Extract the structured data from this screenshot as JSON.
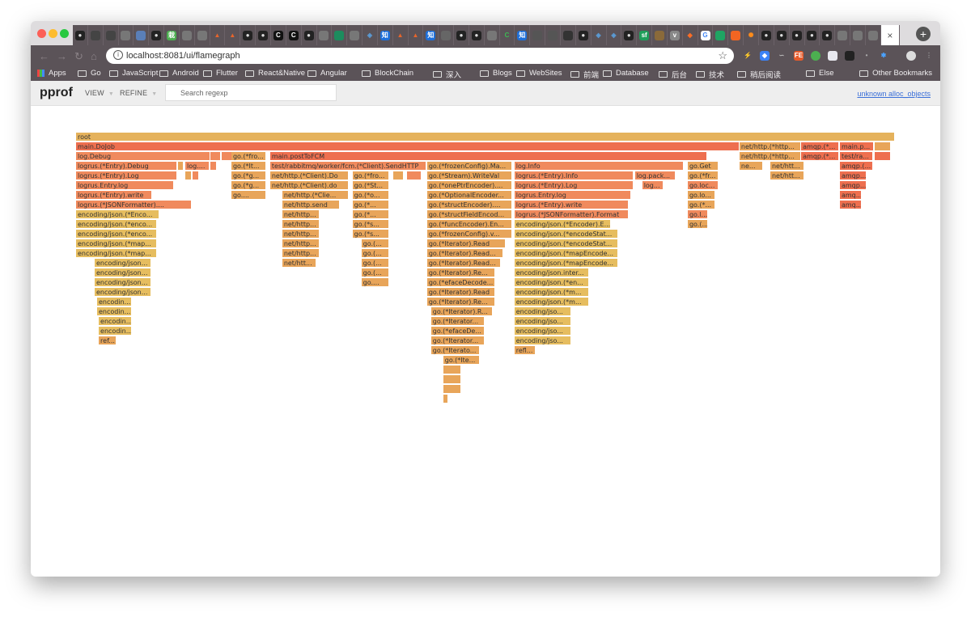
{
  "browser": {
    "tab_icons": [
      "github",
      "cat",
      "cat",
      "gray",
      "avatar",
      "github",
      "kanji-green",
      "gray",
      "gray",
      "triangle-orange",
      "triangle-orange",
      "github",
      "github",
      "c-circle",
      "c-circle",
      "github",
      "gray",
      "green-shield",
      "gray",
      "stack-blue",
      "zhi-blue",
      "triangle-orange",
      "triangle-orange",
      "zhi-blue",
      "book",
      "github",
      "github",
      "gray",
      "c-green",
      "zhi-blue",
      "cat-photo",
      "cat-photo",
      "dark-photo",
      "github",
      "stack-blue",
      "stack-blue",
      "github",
      "sf-green",
      "photo",
      "v-gray",
      "gitlab",
      "google",
      "green-tag",
      "orange-box",
      "gear-orange",
      "github",
      "github",
      "github",
      "github",
      "github",
      "gray",
      "gray",
      "gray"
    ],
    "tab_close": "×",
    "new_tab": "+",
    "address_url": "localhost:8081/ui/flamegraph",
    "bookmarks": [
      {
        "label": "Apps",
        "type": "apps"
      },
      {
        "label": "Go",
        "type": "folder"
      },
      {
        "label": "JavaScript",
        "type": "folder"
      },
      {
        "label": "Android",
        "type": "folder"
      },
      {
        "label": "Flutter",
        "type": "folder"
      },
      {
        "label": "React&Native",
        "type": "folder"
      },
      {
        "label": "Angular",
        "type": "folder"
      },
      {
        "label": "BlockChain",
        "type": "folder"
      },
      {
        "label": "深入",
        "type": "folder"
      },
      {
        "label": "Blogs",
        "type": "folder"
      },
      {
        "label": "WebSites",
        "type": "folder"
      },
      {
        "label": "前端",
        "type": "folder"
      },
      {
        "label": "Database",
        "type": "folder"
      },
      {
        "label": "后台",
        "type": "folder"
      },
      {
        "label": "技术",
        "type": "folder"
      },
      {
        "label": "稍后阅读",
        "type": "folder"
      },
      {
        "label": "Else",
        "type": "folder"
      }
    ],
    "other_bookmarks": "Other Bookmarks"
  },
  "app": {
    "title": "pprof",
    "menu": [
      {
        "label": "VIEW"
      },
      {
        "label": "REFINE"
      }
    ],
    "search_placeholder": "Search regexp",
    "sample_type": "unknown alloc_objects"
  },
  "colors": {
    "warm": "#f08a5d",
    "hot": "#ee6f4f",
    "mid": "#e8a55a",
    "cool": "#e6bd5f",
    "root": "#e5b25c"
  },
  "flamegraph": {
    "frames": [
      {
        "n": "root",
        "d": 0,
        "s": 0,
        "w": 1,
        "c": "root"
      },
      {
        "n": "main.DoJob",
        "d": 1,
        "s": 0,
        "w": 0.8102,
        "c": "hot"
      },
      {
        "n": "net/http.(*http...",
        "d": 1,
        "s": 0.8102,
        "w": 0.0753,
        "c": "mid"
      },
      {
        "n": "amqp.(*...",
        "d": 1,
        "s": 0.8855,
        "w": 0.0464,
        "c": "hot"
      },
      {
        "n": "main.p...",
        "d": 1,
        "s": 0.9328,
        "w": 0.0416,
        "c": "hot"
      },
      {
        "n": "",
        "d": 1,
        "s": 0.9753,
        "w": 0.0198,
        "c": "mid"
      },
      {
        "n": "log.Debug",
        "d": 2,
        "s": 0,
        "w": 0.164,
        "c": "warm"
      },
      {
        "n": "",
        "d": 2,
        "s": 0.164,
        "w": 0.0128,
        "c": "warm"
      },
      {
        "n": "",
        "d": 2,
        "s": 0.1779,
        "w": 0.0128,
        "c": "warm"
      },
      {
        "n": "go.(*fro...",
        "d": 2,
        "s": 0.1897,
        "w": 0.0425,
        "c": "mid"
      },
      {
        "n": "main.postToFCM",
        "d": 2,
        "s": 0.237,
        "w": 0.5336,
        "c": "hot"
      },
      {
        "n": "net/http.(*http...",
        "d": 2,
        "s": 0.8102,
        "w": 0.0753,
        "c": "mid"
      },
      {
        "n": "amqp.(*...",
        "d": 2,
        "s": 0.8855,
        "w": 0.0464,
        "c": "hot"
      },
      {
        "n": "test/ra...",
        "d": 2,
        "s": 0.9328,
        "w": 0.0407,
        "c": "hot"
      },
      {
        "n": "",
        "d": 2,
        "s": 0.9753,
        "w": 0.0198,
        "c": "hot"
      },
      {
        "n": "logrus.(*Entry).Debug",
        "d": 3,
        "s": 0,
        "w": 0.1235,
        "c": "warm"
      },
      {
        "n": "",
        "d": 3,
        "s": 0.1245,
        "w": 0.007,
        "c": "mid"
      },
      {
        "n": "log....",
        "d": 3,
        "s": 0.1334,
        "w": 0.0297,
        "c": "warm"
      },
      {
        "n": "",
        "d": 3,
        "s": 0.164,
        "w": 0.0079,
        "c": "warm"
      },
      {
        "n": "go.(*It...",
        "d": 3,
        "s": 0.1897,
        "w": 0.0425,
        "c": "mid"
      },
      {
        "n": "test/rabbitmq/worker/fcm.(*Client).SendHTTP",
        "d": 3,
        "s": 0.237,
        "w": 0.1907,
        "c": "warm"
      },
      {
        "n": "go.(*frozenConfig).Ma...",
        "d": 3,
        "s": 0.4287,
        "w": 0.1037,
        "c": "mid"
      },
      {
        "n": "log.Info",
        "d": 3,
        "s": 0.5353,
        "w": 0.2065,
        "c": "warm"
      },
      {
        "n": "go.Get",
        "d": 3,
        "s": 0.747,
        "w": 0.0375,
        "c": "mid"
      },
      {
        "n": "ne...",
        "d": 3,
        "s": 0.8102,
        "w": 0.0287,
        "c": "mid"
      },
      {
        "n": "net/htt...",
        "d": 3,
        "s": 0.8478,
        "w": 0.0416,
        "c": "mid"
      },
      {
        "n": "amqp.(...",
        "d": 3,
        "s": 0.9328,
        "w": 0.0407,
        "c": "hot"
      },
      {
        "n": "logrus.(*Entry).Log",
        "d": 4,
        "s": 0,
        "w": 0.1235,
        "c": "warm"
      },
      {
        "n": "",
        "d": 4,
        "s": 0.1334,
        "w": 0.0079,
        "c": "mid"
      },
      {
        "n": "",
        "d": 4,
        "s": 0.1423,
        "w": 0.0079,
        "c": "warm"
      },
      {
        "n": "go.(*g...",
        "d": 4,
        "s": 0.1897,
        "w": 0.0425,
        "c": "mid"
      },
      {
        "n": "net/http.(*Client).Do",
        "d": 4,
        "s": 0.237,
        "w": 0.0958,
        "c": "mid"
      },
      {
        "n": "go.(*fro...",
        "d": 4,
        "s": 0.3376,
        "w": 0.0445,
        "c": "mid"
      },
      {
        "n": "",
        "d": 4,
        "s": 0.3871,
        "w": 0.0128,
        "c": "mid"
      },
      {
        "n": "",
        "d": 4,
        "s": 0.4039,
        "w": 0.0178,
        "c": "warm"
      },
      {
        "n": "go.(*Stream).WriteVal",
        "d": 4,
        "s": 0.4287,
        "w": 0.1037,
        "c": "mid"
      },
      {
        "n": "logrus.(*Entry).Info",
        "d": 4,
        "s": 0.5353,
        "w": 0.1453,
        "c": "warm"
      },
      {
        "n": "log.pack...",
        "d": 4,
        "s": 0.6825,
        "w": 0.0494,
        "c": "warm"
      },
      {
        "n": "go.(*fr...",
        "d": 4,
        "s": 0.747,
        "w": 0.0375,
        "c": "mid"
      },
      {
        "n": "net/htt...",
        "d": 4,
        "s": 0.8478,
        "w": 0.0416,
        "c": "mid"
      },
      {
        "n": "amqp....",
        "d": 4,
        "s": 0.9328,
        "w": 0.0327,
        "c": "hot"
      },
      {
        "n": "logrus.Entry.log",
        "d": 5,
        "s": 0,
        "w": 0.1196,
        "c": "warm"
      },
      {
        "n": "go.(*g...",
        "d": 5,
        "s": 0.1897,
        "w": 0.0425,
        "c": "mid"
      },
      {
        "n": "net/http.(*Client).do",
        "d": 5,
        "s": 0.237,
        "w": 0.0958,
        "c": "mid"
      },
      {
        "n": "go.(*St...",
        "d": 5,
        "s": 0.3376,
        "w": 0.0445,
        "c": "mid"
      },
      {
        "n": "go.(*onePtrEncoder)....",
        "d": 5,
        "s": 0.4287,
        "w": 0.1037,
        "c": "mid"
      },
      {
        "n": "logrus.(*Entry).Log",
        "d": 5,
        "s": 0.5353,
        "w": 0.1453,
        "c": "warm"
      },
      {
        "n": "log...",
        "d": 5,
        "s": 0.6914,
        "w": 0.0257,
        "c": "warm"
      },
      {
        "n": "go.loc...",
        "d": 5,
        "s": 0.747,
        "w": 0.0375,
        "c": "warm"
      },
      {
        "n": "amqp....",
        "d": 5,
        "s": 0.9328,
        "w": 0.0327,
        "c": "hot"
      },
      {
        "n": "logrus.(*Entry).write",
        "d": 6,
        "s": 0,
        "w": 0.0928,
        "c": "warm"
      },
      {
        "n": "go....",
        "d": 6,
        "s": 0.1897,
        "w": 0.0425,
        "c": "mid"
      },
      {
        "n": "net/http.(*Clie...",
        "d": 6,
        "s": 0.2518,
        "w": 0.0811,
        "c": "mid"
      },
      {
        "n": "go.(*o...",
        "d": 6,
        "s": 0.3376,
        "w": 0.0445,
        "c": "mid"
      },
      {
        "n": "go.(*OptionalEncoder...",
        "d": 6,
        "s": 0.4287,
        "w": 0.1037,
        "c": "mid"
      },
      {
        "n": "logrus.Entry.log",
        "d": 6,
        "s": 0.5353,
        "w": 0.1423,
        "c": "warm"
      },
      {
        "n": "go.lo...",
        "d": 6,
        "s": 0.747,
        "w": 0.0336,
        "c": "mid"
      },
      {
        "n": "amq...",
        "d": 6,
        "s": 0.9328,
        "w": 0.0267,
        "c": "hot"
      },
      {
        "n": "logrus.(*JSONFormatter)....",
        "d": 7,
        "s": 0,
        "w": 0.1413,
        "c": "warm"
      },
      {
        "n": "net/http.send",
        "d": 7,
        "s": 0.2518,
        "w": 0.0702,
        "c": "mid"
      },
      {
        "n": "go.(*...",
        "d": 7,
        "s": 0.3376,
        "w": 0.0445,
        "c": "mid"
      },
      {
        "n": "go.(*structEncoder)....",
        "d": 7,
        "s": 0.4287,
        "w": 0.1037,
        "c": "mid"
      },
      {
        "n": "logrus.(*Entry).write",
        "d": 7,
        "s": 0.5353,
        "w": 0.1393,
        "c": "warm"
      },
      {
        "n": "go.(*...",
        "d": 7,
        "s": 0.747,
        "w": 0.0336,
        "c": "mid"
      },
      {
        "n": "amq...",
        "d": 7,
        "s": 0.9328,
        "w": 0.0267,
        "c": "hot"
      },
      {
        "n": "encoding/json.(*Enco...",
        "d": 8,
        "s": 0,
        "w": 0.1015,
        "c": "cool"
      },
      {
        "n": "net/http...",
        "d": 8,
        "s": 0.2518,
        "w": 0.0454,
        "c": "mid"
      },
      {
        "n": "go.(*...",
        "d": 8,
        "s": 0.3376,
        "w": 0.0445,
        "c": "mid"
      },
      {
        "n": "go.(*structFieldEncod...",
        "d": 8,
        "s": 0.4287,
        "w": 0.1037,
        "c": "mid"
      },
      {
        "n": "logrus.(*JSONFormatter).Format",
        "d": 8,
        "s": 0.5353,
        "w": 0.1393,
        "c": "warm"
      },
      {
        "n": "go.l...",
        "d": 8,
        "s": 0.747,
        "w": 0.0247,
        "c": "warm"
      },
      {
        "n": "encoding/json.(*enco...",
        "d": 9,
        "s": 0,
        "w": 0.0988,
        "c": "cool"
      },
      {
        "n": "net/http...",
        "d": 9,
        "s": 0.2518,
        "w": 0.0454,
        "c": "mid"
      },
      {
        "n": "go.(*s...",
        "d": 9,
        "s": 0.3376,
        "w": 0.0445,
        "c": "mid"
      },
      {
        "n": "go.(*funcEncoder).En...",
        "d": 9,
        "s": 0.4287,
        "w": 0.1037,
        "c": "mid"
      },
      {
        "n": "encoding/json.(*Encoder).E...",
        "d": 9,
        "s": 0.5353,
        "w": 0.1176,
        "c": "cool"
      },
      {
        "n": "go.(...",
        "d": 9,
        "s": 0.747,
        "w": 0.0247,
        "c": "mid"
      },
      {
        "n": "encoding/json.(*enco...",
        "d": 10,
        "s": 0,
        "w": 0.0988,
        "c": "cool"
      },
      {
        "n": "net/http...",
        "d": 10,
        "s": 0.2518,
        "w": 0.0454,
        "c": "mid"
      },
      {
        "n": "go.(*s...",
        "d": 10,
        "s": 0.3376,
        "w": 0.0445,
        "c": "mid"
      },
      {
        "n": "go.(*frozenConfig).v...",
        "d": 10,
        "s": 0.4287,
        "w": 0.1037,
        "c": "mid"
      },
      {
        "n": "encoding/json.(*encodeStat...",
        "d": 10,
        "s": 0.5353,
        "w": 0.1265,
        "c": "cool"
      },
      {
        "n": "encoding/json.(*map...",
        "d": 11,
        "s": 0,
        "w": 0.0988,
        "c": "cool"
      },
      {
        "n": "net/http...",
        "d": 11,
        "s": 0.2518,
        "w": 0.0454,
        "c": "mid"
      },
      {
        "n": "go.(...",
        "d": 11,
        "s": 0.3485,
        "w": 0.0336,
        "c": "mid"
      },
      {
        "n": "go.(*Iterator).Read",
        "d": 11,
        "s": 0.4287,
        "w": 0.0958,
        "c": "mid"
      },
      {
        "n": "encoding/json.(*encodeStat...",
        "d": 11,
        "s": 0.5353,
        "w": 0.1265,
        "c": "cool"
      },
      {
        "n": "encoding/json.(*map...",
        "d": 12,
        "s": 0,
        "w": 0.0988,
        "c": "cool"
      },
      {
        "n": "net/http...",
        "d": 12,
        "s": 0.2518,
        "w": 0.0454,
        "c": "mid"
      },
      {
        "n": "go.(...",
        "d": 12,
        "s": 0.3485,
        "w": 0.0336,
        "c": "mid"
      },
      {
        "n": "go.(*Iterator).Read...",
        "d": 12,
        "s": 0.4287,
        "w": 0.0928,
        "c": "mid"
      },
      {
        "n": "encoding/json.(*mapEncode...",
        "d": 12,
        "s": 0.5353,
        "w": 0.1265,
        "c": "cool"
      },
      {
        "n": "encoding/json...",
        "d": 13,
        "s": 0.0227,
        "w": 0.0692,
        "c": "cool"
      },
      {
        "n": "net/htt...",
        "d": 13,
        "s": 0.2518,
        "w": 0.0415,
        "c": "mid"
      },
      {
        "n": "go.(...",
        "d": 13,
        "s": 0.3485,
        "w": 0.0336,
        "c": "mid"
      },
      {
        "n": "go.(*Iterator).Read...",
        "d": 13,
        "s": 0.4287,
        "w": 0.0899,
        "c": "mid"
      },
      {
        "n": "encoding/json.(*mapEncode...",
        "d": 13,
        "s": 0.5353,
        "w": 0.1265,
        "c": "cool"
      },
      {
        "n": "encoding/json...",
        "d": 14,
        "s": 0.0227,
        "w": 0.0692,
        "c": "cool"
      },
      {
        "n": "go.(...",
        "d": 14,
        "s": 0.3485,
        "w": 0.0336,
        "c": "mid"
      },
      {
        "n": "go.(*Iterator).Re...",
        "d": 14,
        "s": 0.4287,
        "w": 0.083,
        "c": "mid"
      },
      {
        "n": "encoding/json.inter...",
        "d": 14,
        "s": 0.5353,
        "w": 0.0909,
        "c": "cool"
      },
      {
        "n": "encoding/json...",
        "d": 15,
        "s": 0.0227,
        "w": 0.0692,
        "c": "cool"
      },
      {
        "n": "go....",
        "d": 15,
        "s": 0.3485,
        "w": 0.0336,
        "c": "mid"
      },
      {
        "n": "go.(*efaceDecode...",
        "d": 15,
        "s": 0.4287,
        "w": 0.083,
        "c": "mid"
      },
      {
        "n": "encoding/json.(*en...",
        "d": 15,
        "s": 0.5353,
        "w": 0.0909,
        "c": "cool"
      },
      {
        "n": "encoding/json...",
        "d": 16,
        "s": 0.0227,
        "w": 0.0692,
        "c": "cool"
      },
      {
        "n": "go.(*Iterator).Read",
        "d": 16,
        "s": 0.4287,
        "w": 0.083,
        "c": "mid"
      },
      {
        "n": "encoding/json.(*m...",
        "d": 16,
        "s": 0.5353,
        "w": 0.0909,
        "c": "cool"
      },
      {
        "n": "encodin...",
        "d": 17,
        "s": 0.0257,
        "w": 0.0425,
        "c": "cool"
      },
      {
        "n": "go.(*Iterator).Re...",
        "d": 17,
        "s": 0.4287,
        "w": 0.083,
        "c": "mid"
      },
      {
        "n": "encoding/json.(*m...",
        "d": 17,
        "s": 0.5353,
        "w": 0.0909,
        "c": "cool"
      },
      {
        "n": "encodin...",
        "d": 18,
        "s": 0.0257,
        "w": 0.0425,
        "c": "cool"
      },
      {
        "n": "go.(*Iterator).R...",
        "d": 18,
        "s": 0.4336,
        "w": 0.0751,
        "c": "mid"
      },
      {
        "n": "encoding/jso...",
        "d": 18,
        "s": 0.5353,
        "w": 0.0692,
        "c": "cool"
      },
      {
        "n": "encodin...",
        "d": 19,
        "s": 0.0277,
        "w": 0.0405,
        "c": "cool"
      },
      {
        "n": "go.(*Iterator...",
        "d": 19,
        "s": 0.4336,
        "w": 0.0652,
        "c": "mid"
      },
      {
        "n": "encoding/jso...",
        "d": 19,
        "s": 0.5353,
        "w": 0.0692,
        "c": "cool"
      },
      {
        "n": "encodin...",
        "d": 20,
        "s": 0.0277,
        "w": 0.0405,
        "c": "cool"
      },
      {
        "n": "go.(*efaceDe...",
        "d": 20,
        "s": 0.4336,
        "w": 0.0652,
        "c": "mid"
      },
      {
        "n": "encoding/jso...",
        "d": 20,
        "s": 0.5353,
        "w": 0.0692,
        "c": "cool"
      },
      {
        "n": "ref...",
        "d": 21,
        "s": 0.0277,
        "w": 0.0217,
        "c": "mid"
      },
      {
        "n": "go.(*Iterator...",
        "d": 21,
        "s": 0.4336,
        "w": 0.0652,
        "c": "mid"
      },
      {
        "n": "encoding/jso...",
        "d": 21,
        "s": 0.5353,
        "w": 0.0692,
        "c": "cool"
      },
      {
        "n": "go.(*Iterato...",
        "d": 22,
        "s": 0.4336,
        "w": 0.0593,
        "c": "mid"
      },
      {
        "n": "refl...",
        "d": 22,
        "s": 0.5353,
        "w": 0.0257,
        "c": "mid"
      },
      {
        "n": "go.(*Ite...",
        "d": 23,
        "s": 0.4484,
        "w": 0.0445,
        "c": "mid"
      },
      {
        "n": "",
        "d": 24,
        "s": 0.4484,
        "w": 0.0217,
        "c": "mid"
      },
      {
        "n": "",
        "d": 25,
        "s": 0.4484,
        "w": 0.0217,
        "c": "mid"
      },
      {
        "n": "",
        "d": 26,
        "s": 0.4484,
        "w": 0.0217,
        "c": "mid"
      },
      {
        "n": "",
        "d": 27,
        "s": 0.4484,
        "w": 0.0059,
        "c": "mid"
      }
    ]
  }
}
